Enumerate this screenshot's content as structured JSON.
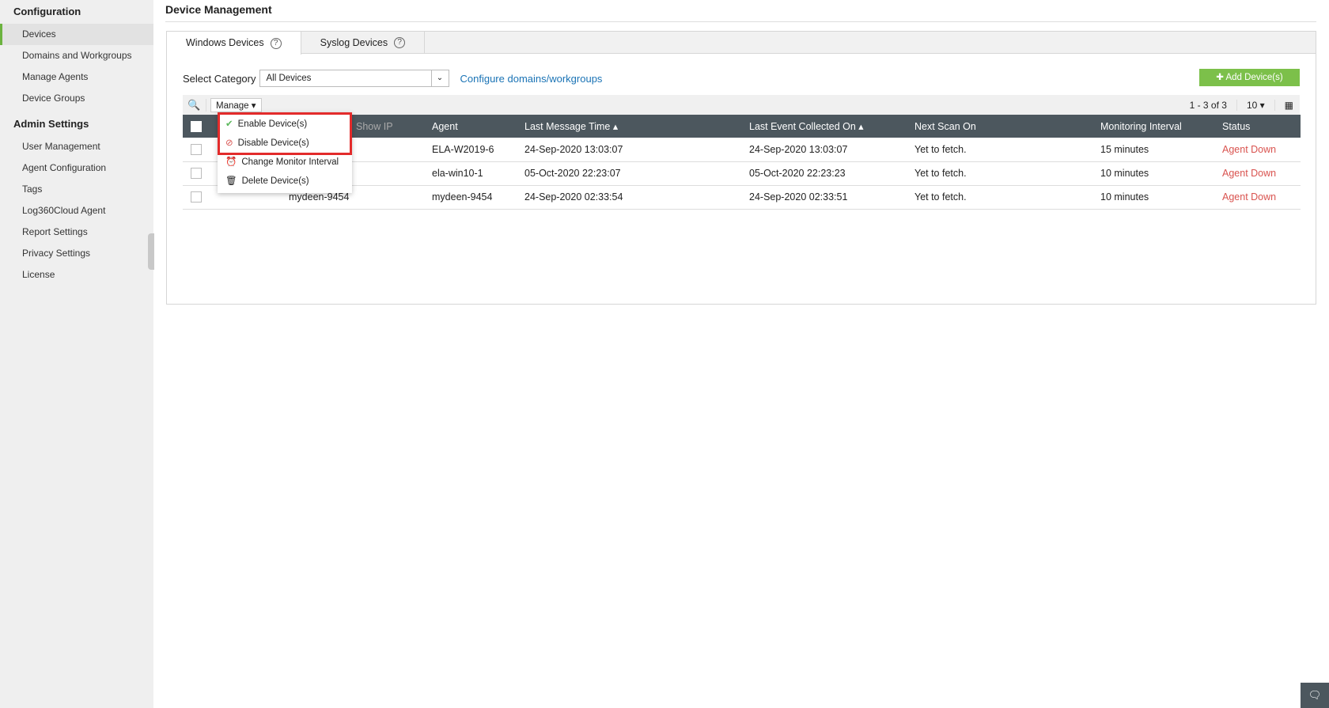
{
  "sidebar": {
    "config_heading": "Configuration",
    "config_items": [
      "Devices",
      "Domains and Workgroups",
      "Manage Agents",
      "Device Groups"
    ],
    "admin_heading": "Admin Settings",
    "admin_items": [
      "User Management",
      "Agent Configuration",
      "Tags",
      "Log360Cloud Agent",
      "Report Settings",
      "Privacy Settings",
      "License"
    ]
  },
  "page_title": "Device Management",
  "tabs": [
    {
      "label": "Windows Devices"
    },
    {
      "label": "Syslog Devices"
    }
  ],
  "category": {
    "label": "Select Category",
    "value": "All Devices",
    "link": "Configure domains/workgroups"
  },
  "add_button": "Add Device(s)",
  "toolbar": {
    "manage": "Manage",
    "range": "1 - 3 of 3",
    "page_size": "10"
  },
  "menu": [
    "Enable Device(s)",
    "Disable Device(s)",
    "Change Monitor Interval",
    "Delete Device(s)"
  ],
  "columns": [
    "Show IP",
    "Agent",
    "Last Message Time",
    "Last Event Collected On",
    "Next Scan On",
    "Monitoring Interval",
    "Status"
  ],
  "rows": [
    {
      "device": "",
      "agent": "ELA-W2019-6",
      "last_msg": "24-Sep-2020 13:03:07",
      "last_event": "24-Sep-2020 13:03:07",
      "next_scan": "Yet to fetch.",
      "interval": "15 minutes",
      "status": "Agent Down"
    },
    {
      "device": "",
      "agent": "ela-win10-1",
      "last_msg": "05-Oct-2020 22:23:07",
      "last_event": "05-Oct-2020 22:23:23",
      "next_scan": "Yet to fetch.",
      "interval": "10 minutes",
      "status": "Agent Down"
    },
    {
      "device": "mydeen-9454",
      "agent": "mydeen-9454",
      "last_msg": "24-Sep-2020 02:33:54",
      "last_event": "24-Sep-2020 02:33:51",
      "next_scan": "Yet to fetch.",
      "interval": "10 minutes",
      "status": "Agent Down"
    }
  ],
  "colors": {
    "accent": "#7cc04a",
    "header": "#4c575e",
    "status_down": "#d9534f",
    "highlight": "#e32b2b"
  }
}
